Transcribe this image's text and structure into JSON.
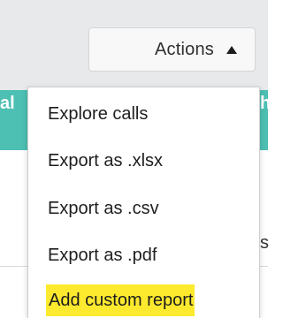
{
  "actions_button": {
    "label": "Actions",
    "icon": "caret-up-icon"
  },
  "background": {
    "teal_left_text": "al",
    "teal_right_text": "ha",
    "row_cut_text": "s",
    "teal_color": "#4dbfb3",
    "bar_color": "#e8e9eb"
  },
  "menu": {
    "items": [
      {
        "label": "Explore calls"
      },
      {
        "label": "Export as .xlsx"
      },
      {
        "label": "Export as .csv"
      },
      {
        "label": "Export as .pdf"
      },
      {
        "label": "Add custom report",
        "highlight_color": "#fde92d"
      }
    ]
  }
}
